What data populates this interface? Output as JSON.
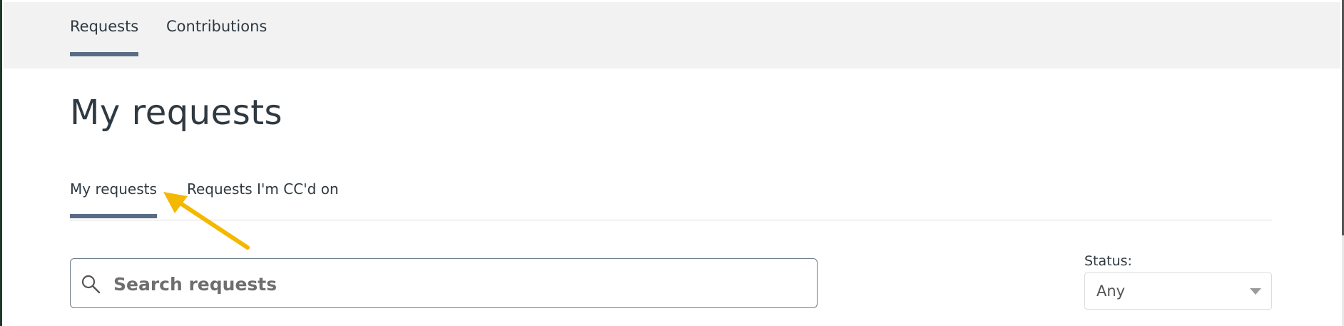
{
  "top_nav": {
    "items": [
      {
        "label": "Requests",
        "active": true
      },
      {
        "label": "Contributions",
        "active": false
      }
    ]
  },
  "page": {
    "title": "My requests"
  },
  "subtabs": [
    {
      "label": "My requests",
      "active": true
    },
    {
      "label": "Requests I'm CC'd on",
      "active": false
    }
  ],
  "search": {
    "placeholder": "Search requests",
    "value": "",
    "icon": "search-icon"
  },
  "status_filter": {
    "label": "Status:",
    "selected": "Any",
    "icon": "chevron-down-icon"
  },
  "annotation": {
    "arrow_color": "#f5b800"
  },
  "colors": {
    "active_underline": "#5a6b85",
    "topbar_bg": "#f2f2f2"
  }
}
